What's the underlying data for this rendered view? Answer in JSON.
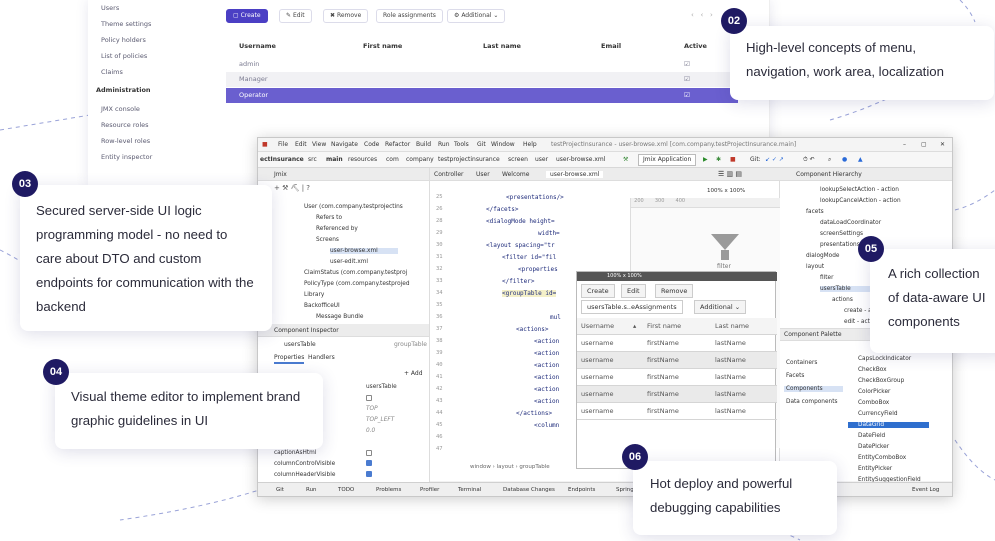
{
  "web": {
    "sidebar": {
      "items_top": [
        "Users",
        "Theme settings",
        "Policy holders",
        "List of policies",
        "Claims"
      ],
      "section_admin": "Administration",
      "items_admin": [
        "JMX console",
        "Resource roles",
        "Row-level roles",
        "Entity inspector"
      ]
    },
    "toolbar": {
      "create": "Create",
      "edit": "Edit",
      "remove": "Remove",
      "role_assignments": "Role assignments",
      "additional": "Additional"
    },
    "table": {
      "columns": [
        "Username",
        "First name",
        "Last name",
        "Email",
        "Active"
      ],
      "rows": [
        "admin",
        "Manager",
        "Operator"
      ]
    }
  },
  "ide": {
    "menu": [
      "File",
      "Edit",
      "View",
      "Navigate",
      "Code",
      "Refactor",
      "Build",
      "Run",
      "Tools",
      "Git",
      "Window",
      "Help"
    ],
    "window_title": "testProjectInsurance - user-browse.xml [com.company.testProjectInsurance.main]",
    "crumbs": [
      "ectInsurance",
      "src",
      "main",
      "resources",
      "com",
      "company",
      "testprojectinsurance",
      "screen",
      "user",
      "user-browse.xml"
    ],
    "run_config": "Jmix Application",
    "git_label": "Git:",
    "left_pane": {
      "title": "Jmix",
      "tree": [
        "User (com.company.testprojectins",
        "Refers to",
        "Referenced by",
        "Screens",
        "user-browse.xml",
        "user-edit.xml",
        "ClaimStatus (com.company.testproj",
        "PolicyType (com.company.testprojed",
        "Library",
        "BackofficeUI",
        "Message Bundle"
      ]
    },
    "inspector": {
      "title": "Component Inspector",
      "component": "usersTable",
      "type": "groupTable",
      "tabs": [
        "Properties",
        "Handlers"
      ],
      "add": "+ Add",
      "rows": [
        {
          "name": "",
          "value": "usersTable"
        },
        {
          "name": "",
          "value": ""
        },
        {
          "name": "",
          "value": "TOP"
        },
        {
          "name": "",
          "value": "TOP_LEFT"
        },
        {
          "name": "",
          "value": "0.0"
        },
        {
          "name": "captionAsHtml",
          "value": ""
        },
        {
          "name": "columnControlVisible",
          "value": ""
        },
        {
          "name": "columnHeaderVisible",
          "value": ""
        }
      ]
    },
    "editor": {
      "tabs": [
        "Controller",
        "User",
        "Welcome",
        "user-browse.xml"
      ],
      "line_numbers": [
        "25",
        "26",
        "28",
        "29",
        "30",
        "31",
        "32",
        "33",
        "34",
        "35",
        "36",
        "37",
        "38",
        "39",
        "40",
        "41",
        "42",
        "43",
        "44",
        "45",
        "46",
        "47"
      ],
      "lines": [
        "<presentations/>",
        "</facets>",
        "<dialogMode height=",
        "width=",
        "<layout spacing=\"tr",
        "<filter id=\"fil",
        "<properties",
        "</filter>",
        "<groupTable id=",
        "mul",
        "",
        "<actions>",
        "<action",
        "<action",
        "<action",
        "<action",
        "<action",
        "<action",
        "</actions>",
        "<column",
        "",
        ""
      ],
      "crumb_bottom": "window  ›  layout  ›  groupTable",
      "zoom": "100% x 100%",
      "preview_zoom": "100% x 100%",
      "filter_label": "filter"
    },
    "preview": {
      "buttons": [
        "Create",
        "Edit",
        "Remove"
      ],
      "dropdown": "usersTable.s..eAssignments",
      "additional": "Additional",
      "columns": [
        "Username",
        "First name",
        "Last name"
      ],
      "rows": [
        [
          "username",
          "firstName",
          "lastName"
        ],
        [
          "username",
          "firstName",
          "lastName"
        ],
        [
          "username",
          "firstName",
          "lastName"
        ],
        [
          "username",
          "firstName",
          "lastName"
        ],
        [
          "username",
          "firstName",
          "lastName"
        ]
      ]
    },
    "hierarchy": {
      "title": "Component Hierarchy",
      "items": [
        "lookupSelectAction - action",
        "lookupCancelAction - action",
        "facets",
        "dataLoadCoordinator",
        "screenSettings",
        "presentations",
        "dialogMode",
        "layout",
        "filter",
        "usersTable",
        "actions",
        "create - action",
        "edit - action"
      ]
    },
    "palette": {
      "title": "Component Palette",
      "categories": [
        "Containers",
        "Facets",
        "Components",
        "Data components"
      ],
      "items": [
        "CapsLockIndicator",
        "CheckBox",
        "CheckBoxGroup",
        "ColorPicker",
        "ComboBox",
        "CurrencyField",
        "DataGrid",
        "DateField",
        "DatePicker",
        "EntityComboBox",
        "EntityPicker",
        "EntitySuggestionField"
      ]
    },
    "statusbar": [
      "Git",
      "Run",
      "TODO",
      "Problems",
      "Profiler",
      "Terminal",
      "Database Changes",
      "Endpoints",
      "Spring",
      "Event Log"
    ]
  },
  "callouts": [
    {
      "num": "02",
      "text": "High-level concepts of menu, navigation, work area, localization"
    },
    {
      "num": "03",
      "text": "Secured server-side UI logic programming model - no need to care about DTO and custom endpoints for communication with the backend"
    },
    {
      "num": "04",
      "text": "Visual theme editor to implement brand graphic guidelines in UI"
    },
    {
      "num": "05",
      "text": "A rich collection of data-aware UI components"
    },
    {
      "num": "06",
      "text": "Hot deploy and powerful debugging capabilities"
    }
  ],
  "colors": {
    "badge": "#1f1a63",
    "primary": "#4b3fc4",
    "selected_row": "#6a5fcf"
  }
}
